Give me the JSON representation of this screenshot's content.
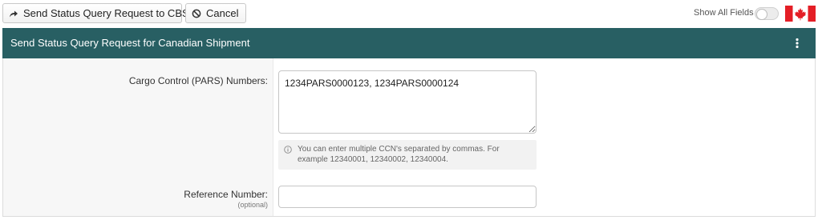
{
  "toolbar": {
    "send_label": "Send Status Query Request to CBSA",
    "cancel_label": "Cancel",
    "show_all_fields_label": "Show All Fields",
    "show_all_fields_on": false,
    "send_icon": "share-arrow-icon",
    "cancel_icon": "ban-icon",
    "flag_icon": "canada-flag-icon"
  },
  "panel": {
    "title": "Send Status Query Request for Canadian Shipment",
    "menu_icon": "kebab-menu-icon",
    "header_color": "#285f63"
  },
  "form": {
    "ccn": {
      "label": "Cargo Control (PARS) Numbers:",
      "value": "1234PARS0000123, 1234PARS0000124",
      "help_icon": "info-icon",
      "help_text": "You can enter multiple CCN's separated by commas. For example 12340001, 12340002, 12340004."
    },
    "reference": {
      "label": "Reference Number:",
      "optional_label": "(optional)",
      "value": ""
    }
  },
  "colors": {
    "flag_red": "#e41e26",
    "label_background": "#f7f7f7",
    "help_background": "#f2f2f2"
  }
}
